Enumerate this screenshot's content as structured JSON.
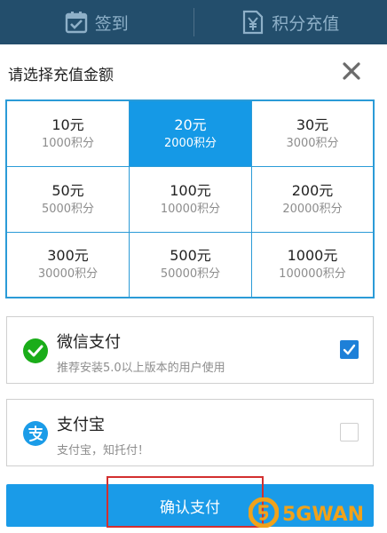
{
  "topbar": {
    "tabs": [
      {
        "label": "签到",
        "icon": "calendar-check-icon"
      },
      {
        "label": "积分充值",
        "icon": "yen-document-icon"
      }
    ]
  },
  "dialog": {
    "title": "请选择充值金额",
    "close_icon": "close-icon"
  },
  "amounts": [
    {
      "amount": "10元",
      "points": "1000积分",
      "selected": false
    },
    {
      "amount": "20元",
      "points": "2000积分",
      "selected": true
    },
    {
      "amount": "30元",
      "points": "3000积分",
      "selected": false
    },
    {
      "amount": "50元",
      "points": "5000积分",
      "selected": false
    },
    {
      "amount": "100元",
      "points": "10000积分",
      "selected": false
    },
    {
      "amount": "200元",
      "points": "20000积分",
      "selected": false
    },
    {
      "amount": "300元",
      "points": "30000积分",
      "selected": false
    },
    {
      "amount": "500元",
      "points": "50000积分",
      "selected": false
    },
    {
      "amount": "1000元",
      "points": "100000积分",
      "selected": false
    }
  ],
  "payment": {
    "wechat": {
      "name": "微信支付",
      "desc": "推荐安装5.0以上版本的用户使用",
      "checked": true,
      "icon": "wechat-pay-icon"
    },
    "alipay": {
      "name": "支付宝",
      "desc": "支付宝，知托付！",
      "checked": false,
      "icon": "alipay-icon"
    }
  },
  "confirm_label": "确认支付",
  "watermark": {
    "text": "5GWAN",
    "icon": "5gwan-logo-icon"
  },
  "colors": {
    "topbar": "#234e6c",
    "accent": "#1599e6",
    "grid_border": "#2b9bd7",
    "wechat_green": "#1aad19",
    "alipay_blue": "#1b9ce8",
    "highlight_red": "#d32f2f",
    "watermark_orange": "#f0a21a"
  }
}
